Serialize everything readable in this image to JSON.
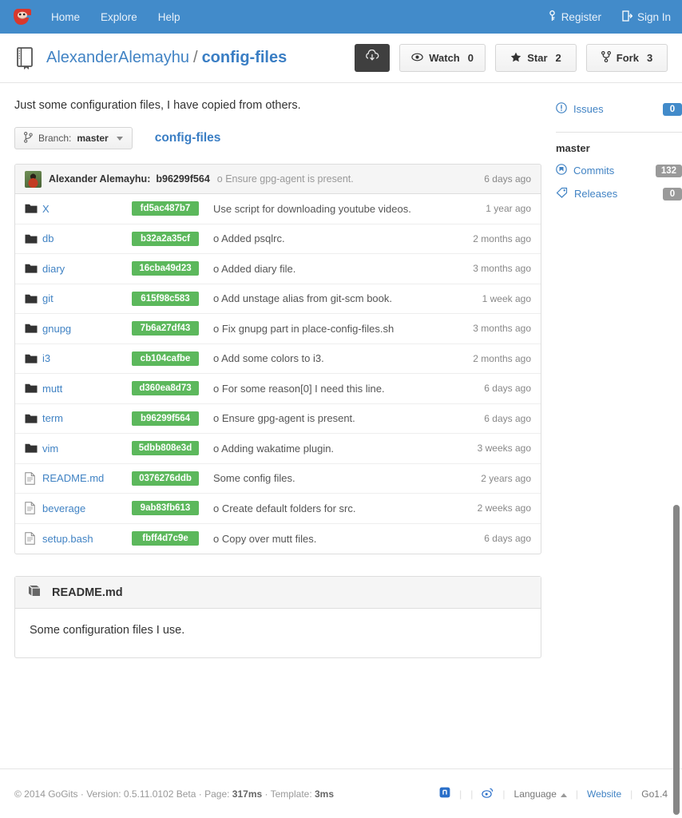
{
  "navbar": {
    "logo_icon": "gogits-logo-icon",
    "links": [
      {
        "label": "Home",
        "icon": ""
      },
      {
        "label": "Explore",
        "icon": ""
      },
      {
        "label": "Help",
        "icon": ""
      }
    ],
    "right": [
      {
        "label": "Register",
        "icon": "key-icon"
      },
      {
        "label": "Sign In",
        "icon": "signin-icon"
      }
    ]
  },
  "repo": {
    "icon": "repo-book-icon",
    "owner": "AlexanderAlemayhu",
    "separator": "/",
    "name": "config-files",
    "clone_button_icon": "cloud-download-icon",
    "actions": [
      {
        "icon": "eye-icon",
        "label": "Watch",
        "count": "0"
      },
      {
        "icon": "star-icon",
        "label": "Star",
        "count": "2"
      },
      {
        "icon": "fork-icon",
        "label": "Fork",
        "count": "3"
      }
    ],
    "description": "Just some configuration files, I have copied from others.",
    "branch_button": {
      "icon": "branch-icon",
      "prefix": "Branch:",
      "value": "master"
    },
    "breadcrumb": "config-files"
  },
  "commit_bar": {
    "avatar": "user-avatar",
    "author": "Alexander Alemayhu:",
    "sha": "b96299f564",
    "message": "o Ensure gpg-agent is present.",
    "time": "6 days ago"
  },
  "files": [
    {
      "type": "dir",
      "icon": "folder-icon",
      "name": "X",
      "sha": "fd5ac487b7",
      "message": "Use script for downloading youtube videos.",
      "time": "1 year ago"
    },
    {
      "type": "dir",
      "icon": "folder-icon",
      "name": "db",
      "sha": "b32a2a35cf",
      "message": "o Added psqlrc.",
      "time": "2 months ago"
    },
    {
      "type": "dir",
      "icon": "folder-icon",
      "name": "diary",
      "sha": "16cba49d23",
      "message": "o Added diary file.",
      "time": "3 months ago"
    },
    {
      "type": "dir",
      "icon": "folder-icon",
      "name": "git",
      "sha": "615f98c583",
      "message": "o Add unstage alias from git-scm book.",
      "time": "1 week ago"
    },
    {
      "type": "dir",
      "icon": "folder-icon",
      "name": "gnupg",
      "sha": "7b6a27df43",
      "message": "o Fix gnupg part in place-config-files.sh",
      "time": "3 months ago"
    },
    {
      "type": "dir",
      "icon": "folder-icon",
      "name": "i3",
      "sha": "cb104cafbe",
      "message": "o Add some colors to i3.",
      "time": "2 months ago"
    },
    {
      "type": "dir",
      "icon": "folder-icon",
      "name": "mutt",
      "sha": "d360ea8d73",
      "message": "o For some reason[0] I need this line.",
      "time": "6 days ago"
    },
    {
      "type": "dir",
      "icon": "folder-icon",
      "name": "term",
      "sha": "b96299f564",
      "message": "o Ensure gpg-agent is present.",
      "time": "6 days ago"
    },
    {
      "type": "dir",
      "icon": "folder-icon",
      "name": "vim",
      "sha": "5dbb808e3d",
      "message": "o Adding wakatime plugin.",
      "time": "3 weeks ago"
    },
    {
      "type": "file",
      "icon": "file-icon",
      "name": "README.md",
      "sha": "0376276ddb",
      "message": "Some config files.",
      "time": "2 years ago"
    },
    {
      "type": "file",
      "icon": "file-icon",
      "name": "beverage",
      "sha": "9ab83fb613",
      "message": "o Create default folders for src.",
      "time": "2 weeks ago"
    },
    {
      "type": "file",
      "icon": "file-icon",
      "name": "setup.bash",
      "sha": "fbff4d7c9e",
      "message": "o Copy over mutt files.",
      "time": "6 days ago"
    }
  ],
  "readme": {
    "icon": "book-icon",
    "title": "README.md",
    "body": "Some configuration files I use."
  },
  "sidebar": {
    "issues": {
      "icon": "issue-icon",
      "label": "Issues",
      "count": "0"
    },
    "branch_label": "master",
    "commits": {
      "icon": "commit-icon",
      "label": "Commits",
      "count": "132"
    },
    "releases": {
      "icon": "tag-icon",
      "label": "Releases",
      "count": "0"
    }
  },
  "footer": {
    "copyright": "© 2014 GoGits · Version: 0.5.11.0102 Beta · Page:",
    "page_time": "317ms",
    "template_sep": "· Template:",
    "template_time": "3ms",
    "github_icon": "github-icon",
    "weibo_icon": "weibo-icon",
    "language": "Language",
    "website": "Website",
    "go_version": "Go1.4"
  },
  "colors": {
    "navbar_blue": "#428bca",
    "link_blue": "#4183c4",
    "sha_green": "#5cb85c",
    "badge_gray": "#9a9a9a",
    "dark_button": "#3f3f3f"
  }
}
